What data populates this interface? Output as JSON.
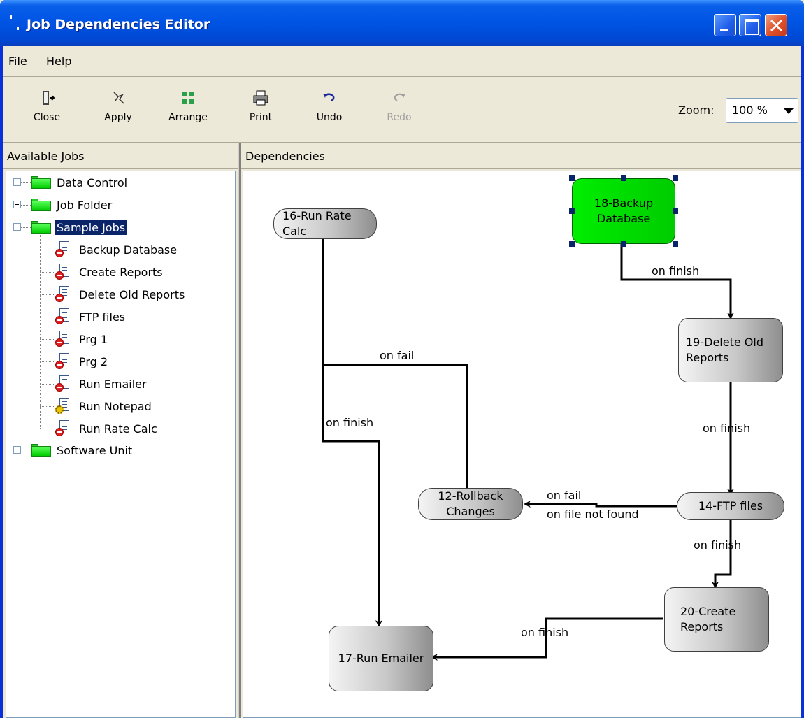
{
  "window": {
    "title": "Job Dependencies Editor"
  },
  "menu": {
    "file": "File",
    "help": "Help"
  },
  "toolbar": {
    "close": "Close",
    "apply": "Apply",
    "arrange": "Arrange",
    "print": "Print",
    "undo": "Undo",
    "redo": "Redo",
    "zoom_label": "Zoom:",
    "zoom_value": "100 %"
  },
  "panels": {
    "left_title": "Available Jobs",
    "right_title": "Dependencies"
  },
  "tree": {
    "folders": [
      "Data Control",
      "Job Folder",
      "Sample Jobs",
      "Software Unit"
    ],
    "jobs": [
      "Backup Database",
      "Create Reports",
      "Delete Old Reports",
      "FTP files",
      "Prg 1",
      "Prg 2",
      "Run Emailer",
      "Run Notepad",
      "Run Rate Calc"
    ]
  },
  "diagram": {
    "nodes": {
      "n16": "16-Run Rate Calc",
      "n18": "18-Backup Database",
      "n19": "19-Delete Old Reports",
      "n12": "12-Rollback Changes",
      "n14": "14-FTP files",
      "n20": "20-Create Reports",
      "n17": "17-Run Emailer"
    },
    "edges": {
      "e18_19": "on finish",
      "e16_12": "on fail",
      "e16_17": "on finish",
      "e19_14": "on finish",
      "e14_12_a": "on fail",
      "e14_12_b": "on file not found",
      "e14_20": "on finish",
      "e20_17": "on finish"
    },
    "selected": "n18",
    "accent": "#00cc00"
  }
}
